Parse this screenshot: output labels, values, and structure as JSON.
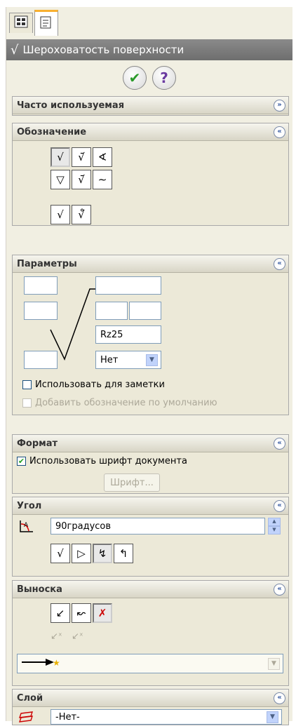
{
  "panel": {
    "title": "Шероховатость поверхности",
    "tabs": [
      "feature-manager-icon",
      "property-manager-icon"
    ]
  },
  "groups": {
    "favorites": {
      "title": "Часто используемая"
    },
    "symbol": {
      "title": "Обозначение"
    },
    "parameters": {
      "title": "Параметры",
      "roughness_value": "Rz25",
      "lay_direction": "Нет",
      "use_for_note_label": "Использовать для заметки",
      "use_for_note_checked": false,
      "default_symbol_label": "Добавить обозначение по умолчанию",
      "default_symbol_checked": false
    },
    "format": {
      "title": "Формат",
      "use_doc_font_label": "Использовать шрифт документа",
      "use_doc_font_checked": true,
      "font_button": "Шрифт..."
    },
    "angle": {
      "title": "Угол",
      "value": "90градусов"
    },
    "leader": {
      "title": "Выноска"
    },
    "layer": {
      "title": "Слой",
      "value": "-Нет-"
    }
  },
  "colors": {
    "title_bar": "#7a7a7a",
    "group_bg": "#ece9d8",
    "ok_green": "#2a9a2a",
    "help_purple": "#6a3aa0"
  }
}
